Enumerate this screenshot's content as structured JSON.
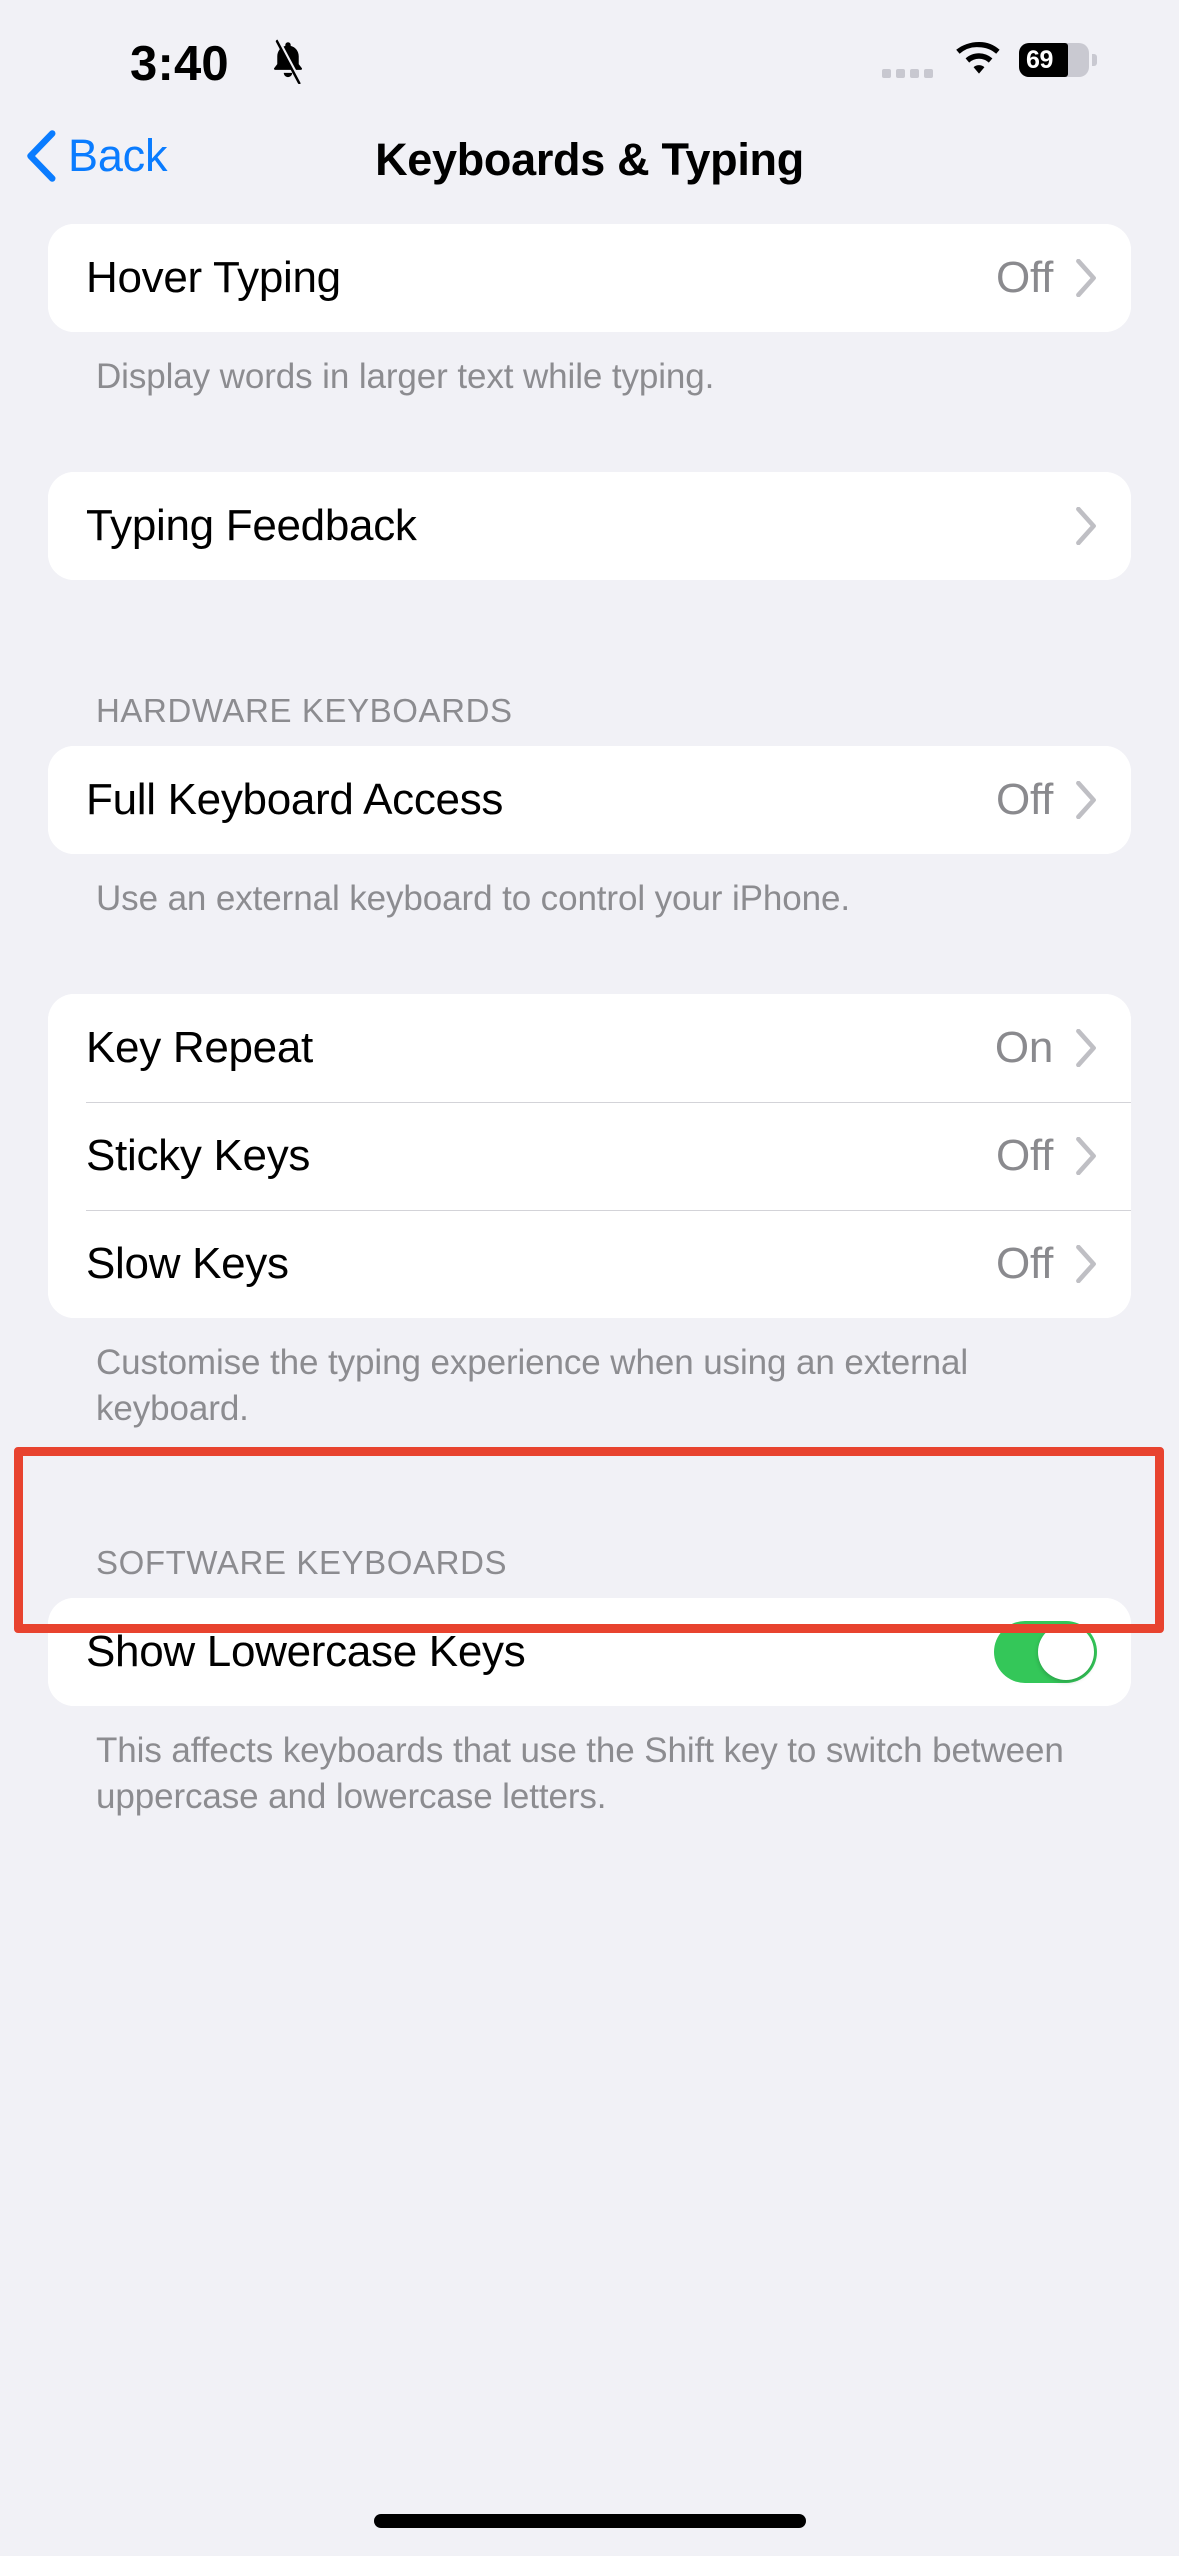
{
  "status_bar": {
    "time": "3:40",
    "silent_icon": "bell-slash-icon",
    "battery_percent": "69",
    "wifi_icon": "wifi-icon",
    "signal_icon": "signal-dots-icon"
  },
  "nav": {
    "back_label": "Back",
    "back_icon": "chevron-left-icon",
    "title": "Keyboards & Typing"
  },
  "sections": [
    {
      "header": "",
      "rows": [
        {
          "label": "Hover Typing",
          "value": "Off",
          "accessory": "chevron"
        }
      ],
      "footer": "Display words in larger text while typing."
    },
    {
      "header": "",
      "rows": [
        {
          "label": "Typing Feedback",
          "value": "",
          "accessory": "chevron"
        }
      ],
      "footer": ""
    },
    {
      "header": "HARDWARE KEYBOARDS",
      "rows": [
        {
          "label": "Full Keyboard Access",
          "value": "Off",
          "accessory": "chevron"
        }
      ],
      "footer": "Use an external keyboard to control your iPhone."
    },
    {
      "header": "",
      "rows": [
        {
          "label": "Key Repeat",
          "value": "On",
          "accessory": "chevron"
        },
        {
          "label": "Sticky Keys",
          "value": "Off",
          "accessory": "chevron"
        },
        {
          "label": "Slow Keys",
          "value": "Off",
          "accessory": "chevron"
        }
      ],
      "footer": "Customise the typing experience when using an external keyboard."
    },
    {
      "header": "SOFTWARE KEYBOARDS",
      "rows": [
        {
          "label": "Show Lowercase Keys",
          "value": "",
          "accessory": "toggle",
          "toggle_on": true
        }
      ],
      "footer": "This affects keyboards that use the Shift key to switch between uppercase and lowercase letters."
    }
  ],
  "highlight": {
    "target": "Slow Keys",
    "color": "#E8432F"
  },
  "colors": {
    "background": "#F1F1F6",
    "cell_background": "#FFFFFF",
    "accent_blue": "#0A7CFF",
    "toggle_green": "#34C759",
    "secondary_text": "#8A8A8E",
    "highlight_red": "#E8432F"
  }
}
